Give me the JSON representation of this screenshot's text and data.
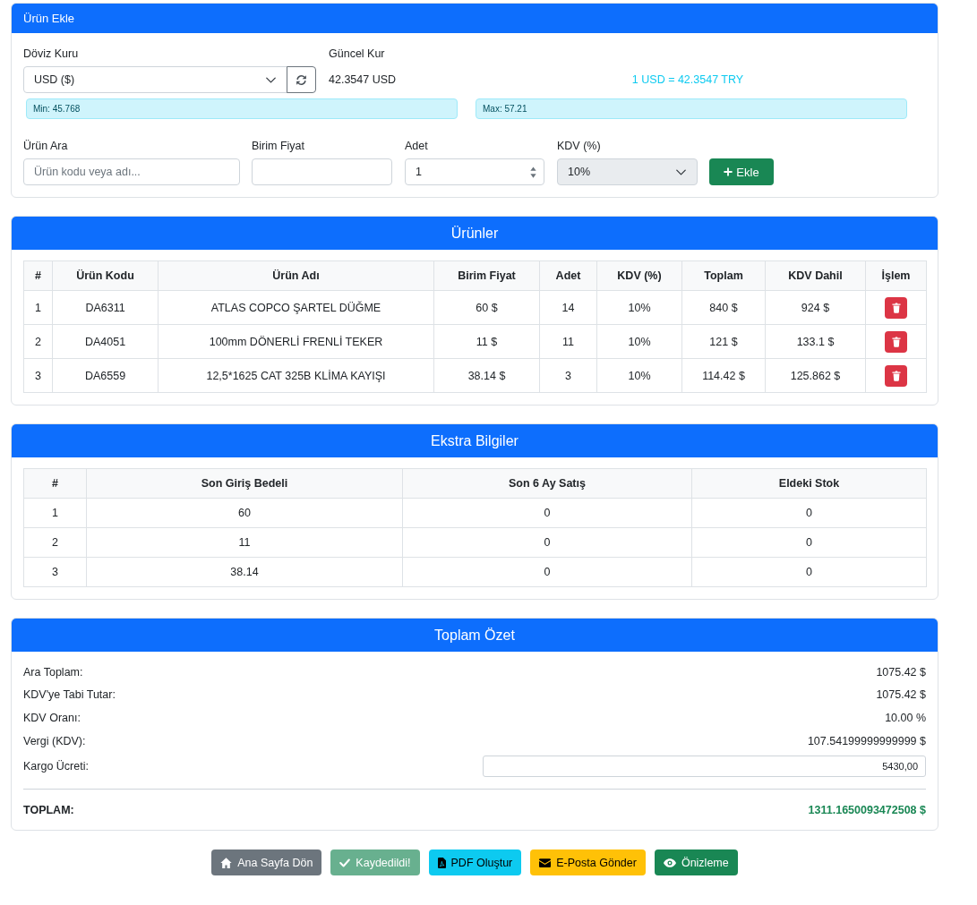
{
  "add_product": {
    "title": "Ürün Ekle",
    "currency": {
      "label": "Döviz Kuru",
      "value": "USD ($)"
    },
    "current_rate": {
      "label": "Güncel Kur",
      "value": "42.3547 USD"
    },
    "conversion": "1 USD = 42.3547 TRY",
    "limits": [
      "Min: 45.768",
      "Max: 57.21"
    ],
    "search": {
      "label": "Ürün Ara",
      "placeholder": "Ürün kodu veya adı..."
    },
    "unit_price": {
      "label": "Birim Fiyat"
    },
    "quantity": {
      "label": "Adet",
      "value": "1"
    },
    "vat": {
      "label": "KDV (%)",
      "value": "10%",
      "disabled": true
    },
    "add_button": "Ekle"
  },
  "products": {
    "title": "Ürünler",
    "columns": [
      "#",
      "Ürün Kodu",
      "Ürün Adı",
      "Birim Fiyat",
      "Adet",
      "KDV (%)",
      "Toplam",
      "KDV Dahil",
      "İşlem"
    ],
    "rows": [
      [
        "1",
        "DA6311",
        "ATLAS COPCO ŞARTEL DÜĞME",
        "60 $",
        "14",
        "10%",
        "840 $",
        "924 $"
      ],
      [
        "2",
        "DA4051",
        "100mm DÖNERLİ FRENLİ TEKER",
        "11 $",
        "11",
        "10%",
        "121 $",
        "133.1 $"
      ],
      [
        "3",
        "DA6559",
        "12,5*1625 CAT 325B KLİMA KAYIŞI",
        "38.14 $",
        "3",
        "10%",
        "114.42 $",
        "125.862 $"
      ]
    ]
  },
  "extra_info": {
    "title": "Ekstra Bilgiler",
    "columns": [
      "#",
      "Son Giriş Bedeli",
      "Son 6 Ay Satış",
      "Eldeki Stok"
    ],
    "rows": [
      [
        "1",
        "60",
        "0",
        "0"
      ],
      [
        "2",
        "11",
        "0",
        "0"
      ],
      [
        "3",
        "38.14",
        "0",
        "0"
      ]
    ]
  },
  "summary": {
    "title": "Toplam Özet",
    "rows": [
      {
        "label": "Ara Toplam:",
        "value": "1075.42 $"
      },
      {
        "label": "KDV'ye Tabi Tutar:",
        "value": "1075.42 $"
      },
      {
        "label": "KDV Oranı:",
        "value": "10.00 %"
      },
      {
        "label": "Vergi (KDV):",
        "value": "107.54199999999999 $"
      }
    ],
    "shipping": {
      "label": "Kargo Ücreti:",
      "value": "5430,00"
    },
    "total": {
      "label": "TOPLAM:",
      "value": "1311.1650093472508 $"
    }
  },
  "actions": [
    {
      "kind": "home",
      "label": "Ana Sayfa Dön",
      "disabled": false
    },
    {
      "kind": "save",
      "label": "Kaydedildi!",
      "disabled": true
    },
    {
      "kind": "pdf",
      "label": "PDF Oluştur",
      "disabled": false
    },
    {
      "kind": "email",
      "label": "E-Posta Gönder",
      "disabled": false
    },
    {
      "kind": "preview",
      "label": "Önizleme",
      "disabled": false
    }
  ]
}
